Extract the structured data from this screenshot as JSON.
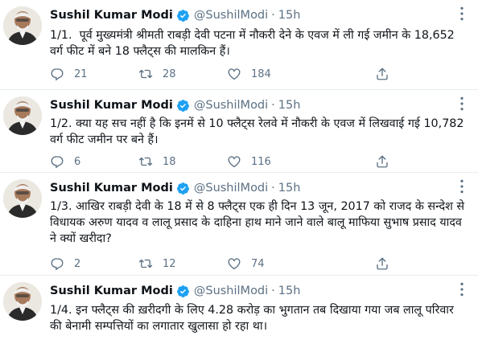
{
  "tweets": [
    {
      "name": "Sushil Kumar Modi",
      "handle": "@SushilModi",
      "separator": "·",
      "time": "15h",
      "text": "1/1.  पूर्व मुख्यमंत्री श्रीमती राबड़ी देवी पटना में नौकरी देने के एवज में ली गई जमीन के 18,652 वर्ग फीट में बने 18 फ्लैट्स की मालकिन हैं।",
      "replies": "21",
      "retweets": "28",
      "likes": "184"
    },
    {
      "name": "Sushil Kumar Modi",
      "handle": "@SushilModi",
      "separator": "·",
      "time": "15h",
      "text": "1/2. क्या यह सच नहीं है कि इनमें से 10 फ्लैट्स रेलवे में नौकरी के एवज में लिखवाई गई 10,782 वर्ग फीट जमीन पर बने हैं।",
      "replies": "6",
      "retweets": "18",
      "likes": "116"
    },
    {
      "name": "Sushil Kumar Modi",
      "handle": "@SushilModi",
      "separator": "·",
      "time": "15h",
      "text": "1/3. आखिर राबड़ी देवी के 18 में से 8 फ्लैट्स एक ही दिन 13 जून, 2017 को राजद के सन्देश से विधायक अरुण यादव व लालू प्रसाद के दाहिना हाथ माने जाने वाले बालू माफिया सुभाष प्रसाद यादव ने क्यों खरीदा?",
      "replies": "2",
      "retweets": "12",
      "likes": "74"
    },
    {
      "name": "Sushil Kumar Modi",
      "handle": "@SushilModi",
      "separator": "·",
      "time": "15h",
      "text": "1/4. इन फ्लैट्स की ख़रीदगी के लिए 4.28 करोड़ का भुगतान तब दिखाया गया जब लालू परिवार की बेनामी सम्पत्तियों का लगातार खुलासा हो रहा था।",
      "replies": "",
      "retweets": "",
      "likes": ""
    }
  ],
  "icons": {
    "verified": "verified-badge-icon",
    "more": "more-options-icon",
    "reply": "reply-icon",
    "retweet": "retweet-icon",
    "like": "like-icon",
    "share": "share-icon"
  },
  "colors": {
    "verified": "#1da1f2",
    "secondary_text": "#5b7083",
    "divider": "#e6ecf0"
  }
}
